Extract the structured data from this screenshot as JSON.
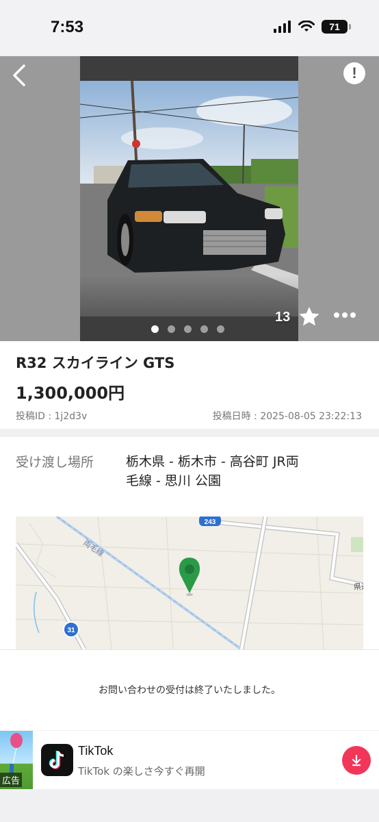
{
  "status_bar": {
    "time": "7:53",
    "battery": "71"
  },
  "listing": {
    "photo_count": 5,
    "active_photo": 0,
    "favorite_count": "13",
    "title": "R32 スカイライン GTS",
    "price": "1,300,000円",
    "post_id": "投稿ID : 1j2d3v",
    "post_date": "投稿日時 : 2025-08-05 23:22:13"
  },
  "handover": {
    "label": "受け渡し場所",
    "value": "栃木県 - 栃木市 - 高谷町 JR両毛線 - 思川 公園"
  },
  "map": {
    "road_243": "243",
    "road_31": "31",
    "rail_label": "両毛線",
    "edge_label": "県道",
    "pin_color": "#2a9a47"
  },
  "notice": {
    "text": "お問い合わせの受付は終了いたしました。"
  },
  "ad": {
    "badge": "広告",
    "app_name": "TikTok",
    "description": "TikTok の楽しさ今すぐ再開",
    "accent": "#f2365a"
  }
}
